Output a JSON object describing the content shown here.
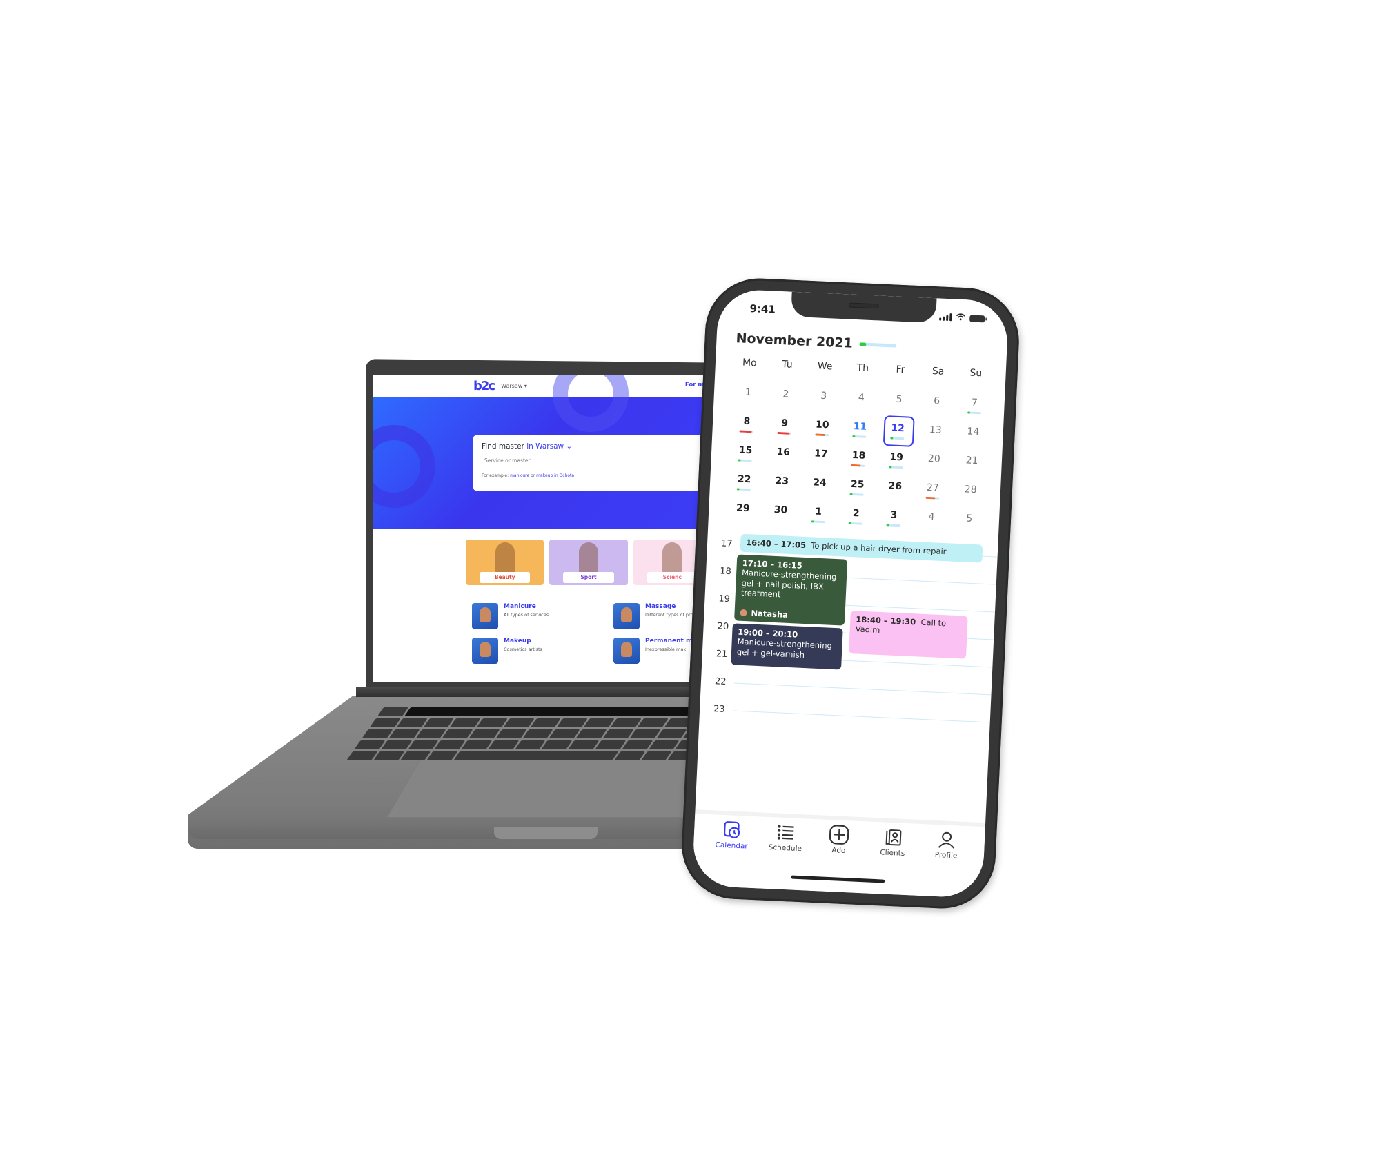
{
  "laptop": {
    "website": {
      "logo": "b2c",
      "city_selector": "Warsaw ▾",
      "for_masters_link": "For mas",
      "search": {
        "title_prefix": "Find master",
        "title_location": "in Warsaw ⌄",
        "input_placeholder": "Service or master",
        "hint_prefix": "For example:",
        "hint_link_1": "manicure",
        "hint_or": "or",
        "hint_link_2": "makeup in Ochota"
      },
      "categories": [
        {
          "label": "Beauty",
          "bg": "#f6b65a",
          "text_color": "#e0503a"
        },
        {
          "label": "Sport",
          "bg": "#cbb9f0",
          "text_color": "#7a3fd6"
        },
        {
          "label": "Scienc",
          "bg": "#fbe1ee",
          "text_color": "#f0607a"
        }
      ],
      "services": [
        {
          "name": "Manicure",
          "description": "All types of services"
        },
        {
          "name": "Massage",
          "description": "Different types of procedures"
        },
        {
          "name": "Makeup",
          "description": "Cosmetics artists"
        },
        {
          "name": "Permanent ma",
          "description": "Inexpressible mak"
        }
      ]
    }
  },
  "phone": {
    "status_bar": {
      "time": "9:41"
    },
    "calendar": {
      "month_title": "November 2021",
      "month_progress": 0.18,
      "weekdays": [
        "Mo",
        "Tu",
        "We",
        "Th",
        "Fr",
        "Sa",
        "Su"
      ],
      "days": [
        {
          "d": "1",
          "style": "muted"
        },
        {
          "d": "2",
          "style": "muted"
        },
        {
          "d": "3",
          "style": "muted"
        },
        {
          "d": "4",
          "style": "muted"
        },
        {
          "d": "5",
          "style": "muted"
        },
        {
          "d": "6",
          "style": "muted"
        },
        {
          "d": "7",
          "style": "muted",
          "load": 0.2,
          "load_color": "#2ecc40"
        },
        {
          "d": "8",
          "style": "bold",
          "load": 0.9,
          "load_color": "#f0393c"
        },
        {
          "d": "9",
          "style": "bold",
          "load": 0.9,
          "load_color": "#f0393c"
        },
        {
          "d": "10",
          "style": "bold",
          "load": 0.7,
          "load_color": "#f26a2c"
        },
        {
          "d": "11",
          "style": "today-near",
          "load": 0.2,
          "load_color": "#2ecc40"
        },
        {
          "d": "12",
          "style": "selected",
          "load": 0.2,
          "load_color": "#2ecc40"
        },
        {
          "d": "13",
          "style": "muted"
        },
        {
          "d": "14",
          "style": "muted"
        },
        {
          "d": "15",
          "style": "bold",
          "load": 0.2,
          "load_color": "#2ecc40"
        },
        {
          "d": "16",
          "style": "bold"
        },
        {
          "d": "17",
          "style": "bold"
        },
        {
          "d": "18",
          "style": "bold",
          "load": 0.7,
          "load_color": "#f26a2c"
        },
        {
          "d": "19",
          "style": "bold",
          "load": 0.2,
          "load_color": "#2ecc40"
        },
        {
          "d": "20",
          "style": "muted"
        },
        {
          "d": "21",
          "style": "muted"
        },
        {
          "d": "22",
          "style": "bold",
          "load": 0.2,
          "load_color": "#2ecc40"
        },
        {
          "d": "23",
          "style": "bold"
        },
        {
          "d": "24",
          "style": "bold"
        },
        {
          "d": "25",
          "style": "bold",
          "load": 0.2,
          "load_color": "#2ecc40"
        },
        {
          "d": "26",
          "style": "bold"
        },
        {
          "d": "27",
          "style": "muted",
          "load": 0.7,
          "load_color": "#f26a2c"
        },
        {
          "d": "28",
          "style": "muted"
        },
        {
          "d": "29",
          "style": "bold"
        },
        {
          "d": "30",
          "style": "bold"
        },
        {
          "d": "1",
          "style": "bold",
          "load": 0.2,
          "load_color": "#2ecc40"
        },
        {
          "d": "2",
          "style": "bold",
          "load": 0.2,
          "load_color": "#2ecc40"
        },
        {
          "d": "3",
          "style": "bold",
          "load": 0.2,
          "load_color": "#2ecc40"
        },
        {
          "d": "4",
          "style": "muted"
        },
        {
          "d": "5",
          "style": "muted"
        }
      ]
    },
    "timeline": {
      "hours": [
        "17",
        "18",
        "19",
        "20",
        "21",
        "22",
        "23"
      ],
      "events": [
        {
          "time": "16:40 – 17:05",
          "title": "To pick up a hair dryer from repair",
          "color": "cyan"
        },
        {
          "time": "17:10 – 16:15",
          "title": "Manicure-strengthening gel + nail polish, IBX treatment",
          "client": "Natasha",
          "color": "green"
        },
        {
          "time": "19:00 – 20:10",
          "title": "Manicure-strengthening gel + gel-varnish",
          "color": "navy"
        },
        {
          "time": "18:40 – 19:30",
          "title": "Call to Vadim",
          "color": "pink"
        }
      ]
    },
    "tabbar": {
      "items": [
        {
          "label": "Calendar",
          "icon": "calendar-clock-icon",
          "active": true
        },
        {
          "label": "Schedule",
          "icon": "list-icon",
          "active": false
        },
        {
          "label": "Add",
          "icon": "plus-square-icon",
          "active": false
        },
        {
          "label": "Clients",
          "icon": "contacts-icon",
          "active": false
        },
        {
          "label": "Profile",
          "icon": "person-icon",
          "active": false
        }
      ]
    }
  },
  "colors": {
    "accent": "#3b3bef",
    "hero_blue": "#3d3df5",
    "load_green": "#2ecc40",
    "load_red": "#f0393c",
    "load_orange": "#f26a2c"
  }
}
